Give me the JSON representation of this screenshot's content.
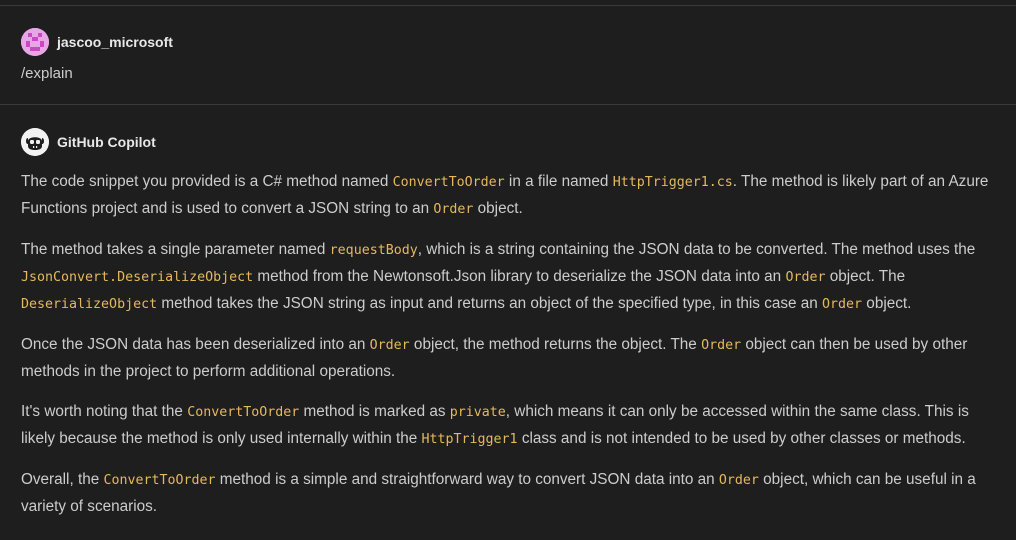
{
  "request": {
    "user_name": "jascoo_microsoft",
    "message": "/explain",
    "avatar_icon": "user-avatar-icon"
  },
  "response": {
    "author_name": "GitHub Copilot",
    "avatar_icon": "copilot-icon",
    "paragraphs": [
      [
        {
          "t": "text",
          "v": "The code snippet you provided is a C# method named "
        },
        {
          "t": "code",
          "v": "ConvertToOrder"
        },
        {
          "t": "text",
          "v": " in a file named "
        },
        {
          "t": "code",
          "v": "HttpTrigger1.cs"
        },
        {
          "t": "text",
          "v": ". The method is likely part of an Azure Functions project and is used to convert a JSON string to an "
        },
        {
          "t": "code",
          "v": "Order"
        },
        {
          "t": "text",
          "v": " object."
        }
      ],
      [
        {
          "t": "text",
          "v": "The method takes a single parameter named "
        },
        {
          "t": "code",
          "v": "requestBody"
        },
        {
          "t": "text",
          "v": ", which is a string containing the JSON data to be converted. The method uses the "
        },
        {
          "t": "code",
          "v": "JsonConvert.DeserializeObject"
        },
        {
          "t": "text",
          "v": " method from the Newtonsoft.Json library to deserialize the JSON data into an "
        },
        {
          "t": "code",
          "v": "Order"
        },
        {
          "t": "text",
          "v": " object. The "
        },
        {
          "t": "code",
          "v": "DeserializeObject"
        },
        {
          "t": "text",
          "v": " method takes the JSON string as input and returns an object of the specified type, in this case an "
        },
        {
          "t": "code",
          "v": "Order"
        },
        {
          "t": "text",
          "v": " object."
        }
      ],
      [
        {
          "t": "text",
          "v": "Once the JSON data has been deserialized into an "
        },
        {
          "t": "code",
          "v": "Order"
        },
        {
          "t": "text",
          "v": " object, the method returns the object. The "
        },
        {
          "t": "code",
          "v": "Order"
        },
        {
          "t": "text",
          "v": " object can then be used by other methods in the project to perform additional operations."
        }
      ],
      [
        {
          "t": "text",
          "v": "It's worth noting that the "
        },
        {
          "t": "code",
          "v": "ConvertToOrder"
        },
        {
          "t": "text",
          "v": " method is marked as "
        },
        {
          "t": "code",
          "v": "private"
        },
        {
          "t": "text",
          "v": ", which means it can only be accessed within the same class. This is likely because the method is only used internally within the "
        },
        {
          "t": "code",
          "v": "HttpTrigger1"
        },
        {
          "t": "text",
          "v": " class and is not intended to be used by other classes or methods."
        }
      ],
      [
        {
          "t": "text",
          "v": "Overall, the "
        },
        {
          "t": "code",
          "v": "ConvertToOrder"
        },
        {
          "t": "text",
          "v": " method is a simple and straightforward way to convert JSON data into an "
        },
        {
          "t": "code",
          "v": "Order"
        },
        {
          "t": "text",
          "v": " object, which can be useful in a variety of scenarios."
        }
      ]
    ]
  },
  "colors": {
    "background": "#1e1e1e",
    "text": "#cccccc",
    "inline_code": "#e4b95c",
    "divider": "#3a3a3a",
    "user_avatar": "#e9a6e6"
  }
}
